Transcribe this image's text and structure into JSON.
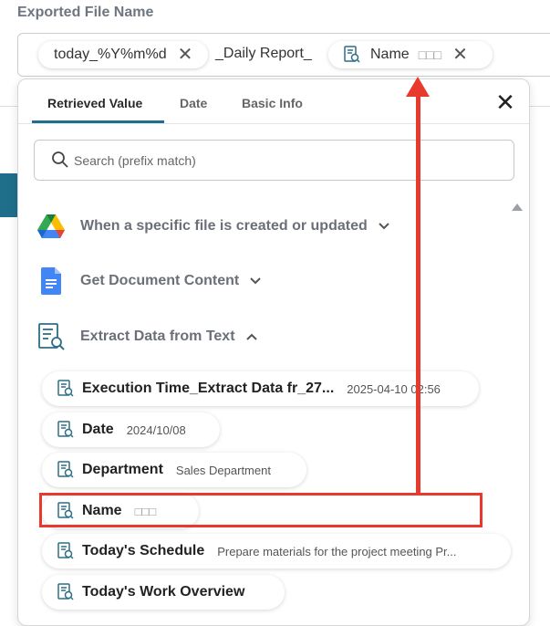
{
  "field": {
    "label": "Exported File Name",
    "chip1": "today_%Y%m%d",
    "literal": "_Daily Report_",
    "chip2": "Name",
    "chip2_val": "□□□"
  },
  "tabs": [
    {
      "label": "Retrieved Value"
    },
    {
      "label": "Date"
    },
    {
      "label": "Basic Info"
    }
  ],
  "search": {
    "placeholder": "Search (prefix match)"
  },
  "sections": [
    {
      "label": "When a specific file is created or updated",
      "icon": "google-drive-icon",
      "caret": "⌄"
    },
    {
      "label": "Get Document Content",
      "icon": "google-docs-icon",
      "caret": "⌄"
    },
    {
      "label": "Extract Data from Text",
      "icon": "extract-text-icon",
      "caret": "⌃"
    }
  ],
  "items": [
    {
      "name": "Execution Time_Extract Data fr_27...",
      "value": "2025-04-10 02:56"
    },
    {
      "name": "Date",
      "value": "2024/10/08"
    },
    {
      "name": "Department",
      "value": "Sales Department"
    },
    {
      "name": "Name",
      "value": "□□□"
    },
    {
      "name": "Today's Schedule",
      "value": "Prepare materials for the project meeting Pr..."
    },
    {
      "name": "Today's Work Overview",
      "value": ""
    }
  ],
  "colors": {
    "accent": "#1f6f8b",
    "highlight": "#e83a2c"
  }
}
